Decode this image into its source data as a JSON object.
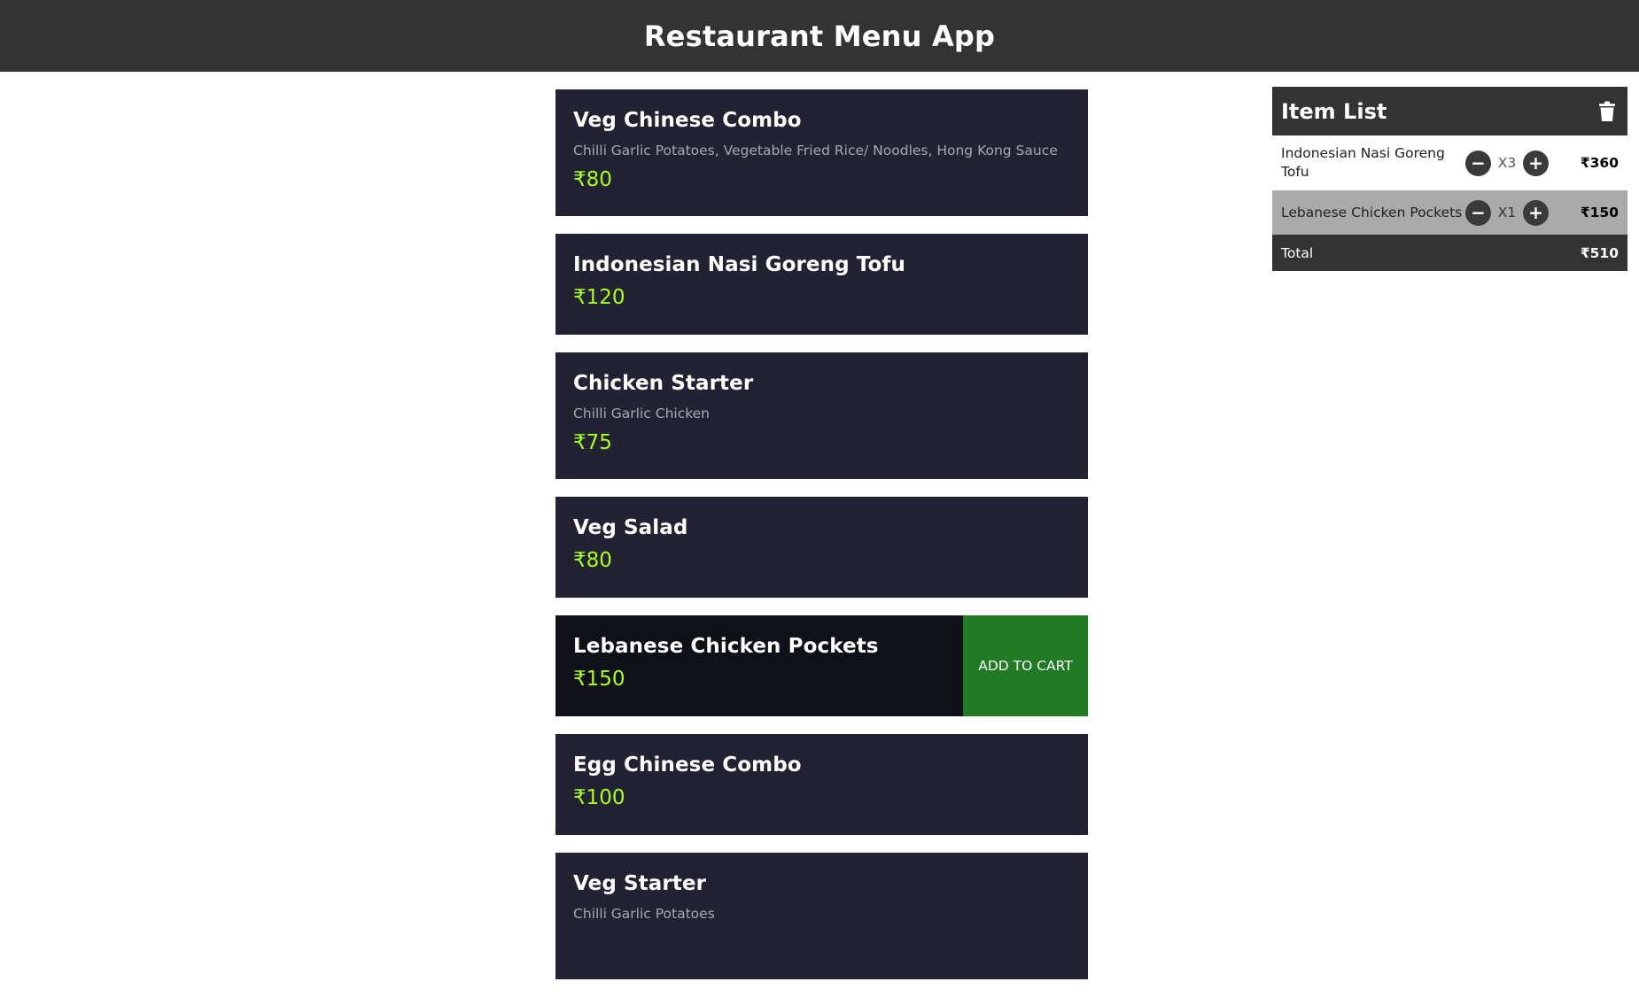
{
  "app": {
    "title": "Restaurant Menu App"
  },
  "menu": {
    "add_to_cart_label": "ADD TO CART",
    "items": [
      {
        "name": "Veg Chinese Combo",
        "description": "Chilli Garlic Potatoes, Vegetable Fried Rice/ Noodles, Hong Kong Sauce",
        "price": "₹80"
      },
      {
        "name": "Indonesian Nasi Goreng Tofu",
        "description": "",
        "price": "₹120"
      },
      {
        "name": "Chicken Starter",
        "description": "Chilli Garlic Chicken",
        "price": "₹75"
      },
      {
        "name": "Veg Salad",
        "description": "",
        "price": "₹80"
      },
      {
        "name": "Lebanese Chicken Pockets",
        "description": "",
        "price": "₹150"
      },
      {
        "name": "Egg Chinese Combo",
        "description": "",
        "price": "₹100"
      },
      {
        "name": "Veg Starter",
        "description": "Chilli Garlic Potatoes",
        "price": ""
      }
    ]
  },
  "cart": {
    "title": "Item List",
    "items": [
      {
        "name": "Indonesian Nasi Goreng Tofu",
        "qty": "X3",
        "amount": "₹360"
      },
      {
        "name": "Lebanese Chicken Pockets",
        "qty": "X1",
        "amount": "₹150"
      }
    ],
    "total_label": "Total",
    "total_value": "₹510",
    "decrement_symbol": "−",
    "increment_symbol": "+"
  },
  "colors": {
    "header_bg": "#333333",
    "card_bg": "#222233",
    "price_color": "#a8ff1e",
    "add_button_bg": "#217a24",
    "selected_row_bg": "#aaaaaa"
  },
  "icons": {
    "cart_clear": "trash-icon"
  }
}
